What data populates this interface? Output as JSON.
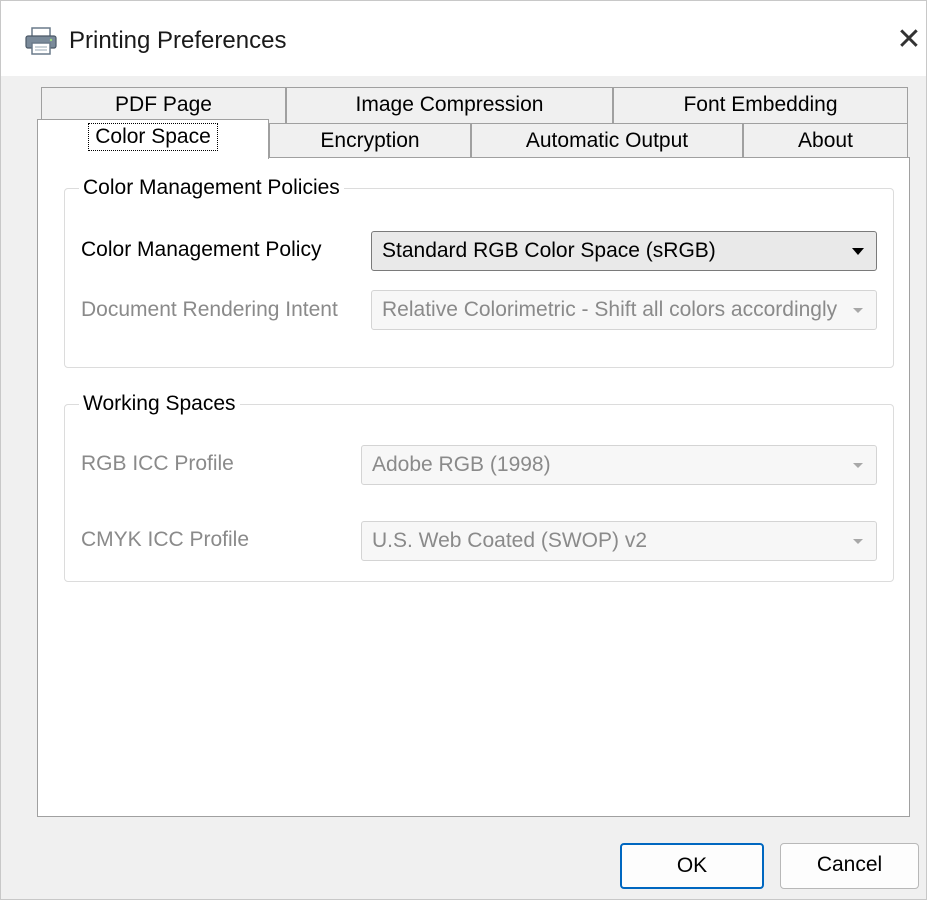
{
  "window": {
    "title": "Printing Preferences",
    "close_glyph": "✕",
    "title_icon": "printer-icon"
  },
  "tabs": {
    "row1": [
      {
        "label": "PDF Page"
      },
      {
        "label": "Image Compression"
      },
      {
        "label": "Font Embedding"
      }
    ],
    "row2": [
      {
        "label": "Color Space",
        "active": true
      },
      {
        "label": "Encryption"
      },
      {
        "label": "Automatic Output"
      },
      {
        "label": "About"
      }
    ]
  },
  "color_management": {
    "group_title": "Color Management Policies",
    "policy_label": "Color Management Policy",
    "policy_value": "Standard RGB Color Space (sRGB)",
    "intent_label": "Document Rendering Intent",
    "intent_value": "Relative Colorimetric - Shift all colors accordingly a"
  },
  "working_spaces": {
    "group_title": "Working Spaces",
    "rgb_label": "RGB ICC Profile",
    "rgb_value": "Adobe RGB (1998)",
    "cmyk_label": "CMYK ICC Profile",
    "cmyk_value": "U.S. Web Coated (SWOP) v2"
  },
  "buttons": {
    "ok": "OK",
    "cancel": "Cancel"
  },
  "colors": {
    "accent": "#0067c0",
    "disabled_text": "#8a8a8a"
  }
}
